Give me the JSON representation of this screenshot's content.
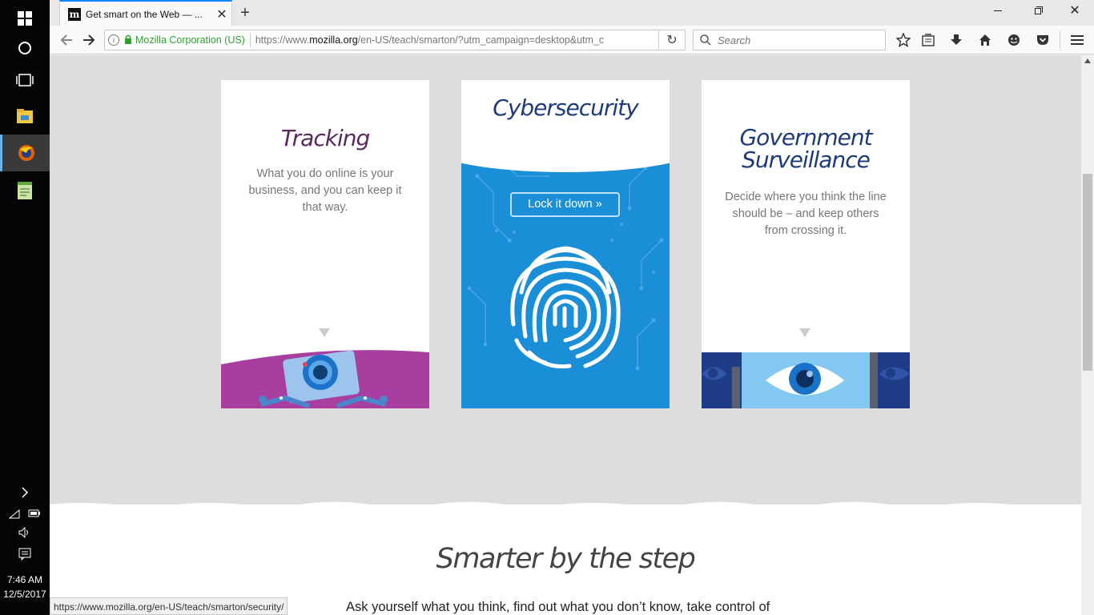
{
  "taskbar": {
    "time": "7:46 AM",
    "date": "12/5/2017",
    "icons": [
      "windows-icon",
      "cortana-icon",
      "task-view-icon",
      "file-explorer-icon",
      "firefox-icon",
      "notepad-icon"
    ]
  },
  "browser": {
    "tab_title": "Get smart on the Web — ...",
    "tab_favicon": "m",
    "security_identity": "Mozilla Corporation (US)",
    "url_prefix": "https://www.",
    "url_domain": "mozilla.org",
    "url_path": "/en-US/teach/smarton/?utm_campaign=desktop&utm_c",
    "search_placeholder": "Search",
    "status_url": "https://www.mozilla.org/en-US/teach/smarton/security/"
  },
  "page": {
    "cards": [
      {
        "title": "Tracking",
        "text": "What you do online is your business, and you can keep it that way."
      },
      {
        "title": "Cybersecurity",
        "button": "Lock it down »"
      },
      {
        "title_line1": "Government",
        "title_line2": "Surveillance",
        "text": "Decide where you think the line should be – and keep others from crossing it."
      }
    ],
    "section_title": "Smarter by the step",
    "section_text": "Ask yourself what you think, find out what you don’t know, take control of"
  },
  "colors": {
    "accent": "#0a84ff",
    "cyber_blue": "#1a8fd8",
    "tracking_purple": "#a83fa0",
    "surveillance_navy": "#1f3d86",
    "title_navy": "#1d3b7a"
  }
}
